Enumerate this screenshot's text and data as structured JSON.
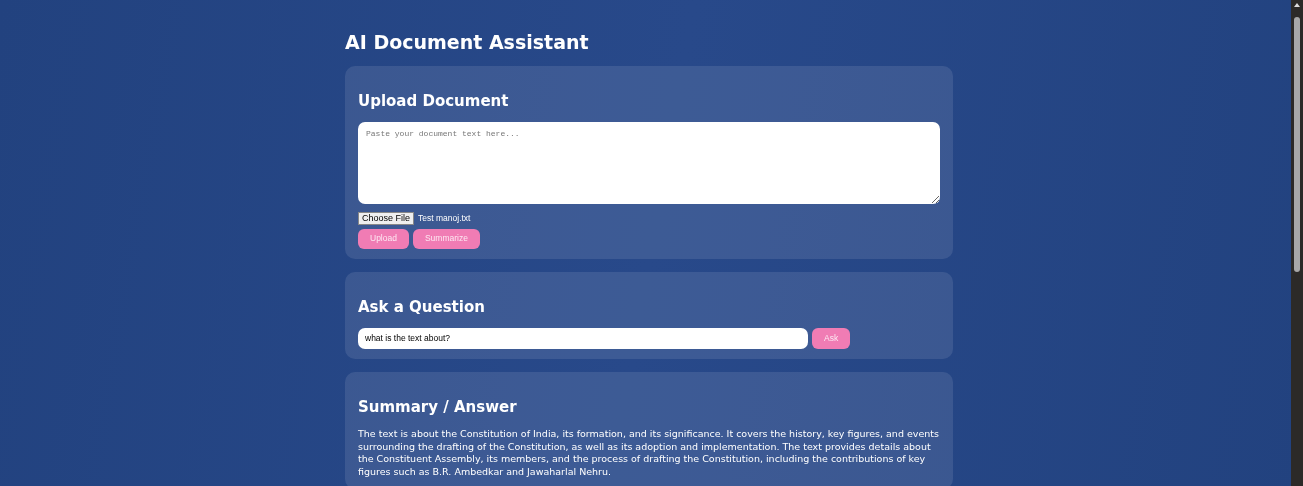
{
  "title": "AI Document Assistant",
  "upload": {
    "heading": "Upload Document",
    "textarea": {
      "placeholder": "Paste your document text here..."
    },
    "file": {
      "button_label": "Choose File",
      "file_name": "Test manoj.txt"
    },
    "buttons": [
      "Upload",
      "Summarize"
    ]
  },
  "question": {
    "heading": "Ask a Question",
    "input": {
      "value": "what is the text about?"
    },
    "button": "Ask"
  },
  "answer": {
    "heading": "Summary / Answer",
    "text": "The text is about the Constitution of India, its formation, and its significance. It covers the history, key figures, and events surrounding the drafting of the Constitution, as well as its adoption and implementation. The text provides details about the Constituent Assembly, its members, and the process of drafting the Constitution, including the contributions of key figures such as B.R. Ambedkar and Jawaharlal Nehru."
  }
}
